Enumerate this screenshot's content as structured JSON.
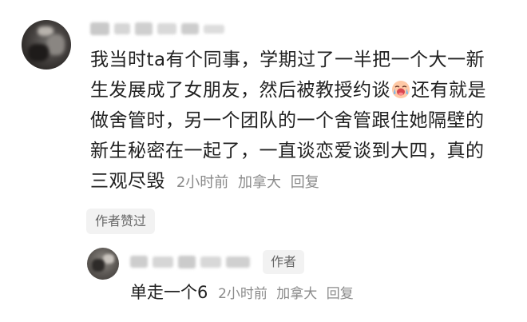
{
  "comment": {
    "lines": [
      "我当时ta有个同事，学期过了一半把一个大一新",
      "生发展成了女朋友，然后被教授约谈",
      "还有就是",
      "做舍管时，另一个团队的一个舍管跟住她隔壁的",
      "新生秘密在一起了，一直谈恋爱谈到大四，真的",
      "三观尽毁"
    ],
    "emoji": "crying-face-emoji",
    "time": "2小时前",
    "location": "加拿大",
    "reply_label": "回复",
    "liked_badge": "作者赞过"
  },
  "reply": {
    "author_tag": "作者",
    "text": "单走一个6",
    "time": "2小时前",
    "location": "加拿大",
    "reply_label": "回复"
  },
  "colors": {
    "text": "#222222",
    "meta": "#8a8a8a",
    "badge_bg": "#f2f2f2",
    "badge_text": "#666666"
  }
}
